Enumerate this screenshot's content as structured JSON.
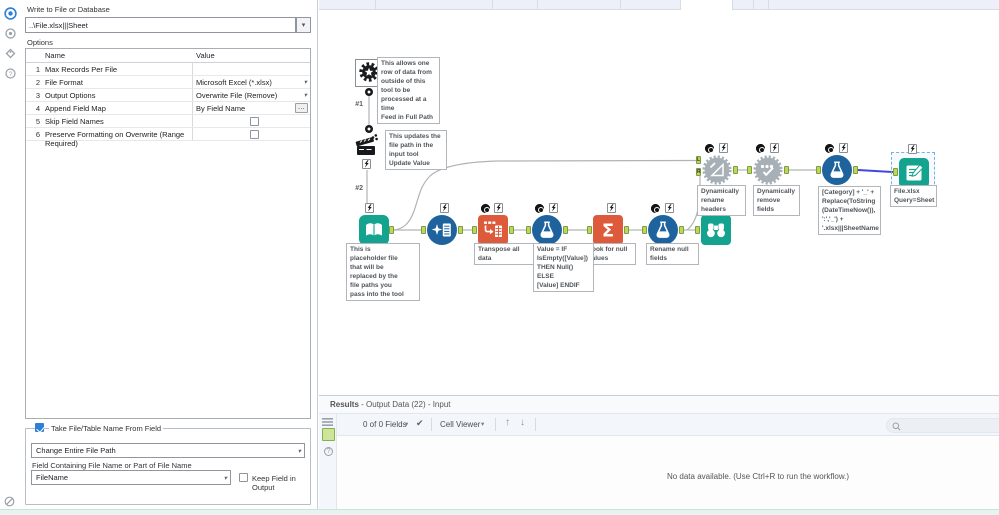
{
  "config_panel": {
    "title": "Write to File or Database",
    "path_value": "..\\File.xlsx|||Sheet",
    "options_label": "Options",
    "table": {
      "col_name": "Name",
      "col_value": "Value",
      "rows": [
        {
          "num": "1",
          "name": "Max Records Per File",
          "value": "",
          "type": "text"
        },
        {
          "num": "2",
          "name": "File Format",
          "value": "Microsoft Excel (*.xlsx)",
          "type": "select"
        },
        {
          "num": "3",
          "name": "Output Options",
          "value": "Overwrite File (Remove)",
          "type": "select"
        },
        {
          "num": "4",
          "name": "Append Field Map",
          "value": "By Field Name",
          "type": "button"
        },
        {
          "num": "5",
          "name": "Skip Field Names",
          "value": "",
          "type": "checkbox",
          "checked": false
        },
        {
          "num": "6",
          "name": "Preserve Formatting on Overwrite (Range Required)",
          "value": "",
          "type": "checkbox",
          "checked": false
        }
      ]
    },
    "group": {
      "legend": "Take File/Table Name From Field",
      "legend_checked": true,
      "mode_select": "Change Entire File Path",
      "field_label": "Field Containing File Name or Part of File Name",
      "field_select": "FileName",
      "keep_checkbox_label": "Keep Field in Output",
      "keep_checked": false
    }
  },
  "canvas": {
    "connection_labels": {
      "c1": "#1",
      "c2": "#2"
    },
    "anchor_letters": {
      "l": "L",
      "r": "R"
    },
    "comments": {
      "macro_input": "This allows one\nrow of data from\noutside of this\ntool to be\nprocessed at a\ntime\nFeed in Full Path",
      "action": "This updates the\nfile path in the\ninput tool\nUpdate Value",
      "input_data": "This is\nplaceholder file\nthat will be\nreplaced by the\nfile paths you\npass into the tool"
    },
    "captions": {
      "transpose": "Transpose all data",
      "formula1": "Value = IF\nIsEmpty([Value])\nTHEN Null() ELSE\n[Value] ENDIF",
      "summarize": "Look for null\nvalues",
      "formula2": "Rename null\nfields",
      "dynamic_rename": "Dynamically\nrename headers",
      "dynamic_select": "Dynamically\nremove fields",
      "formula3": "[Category] + '_' +\nReplace(ToString\n(DateTimeNow()),\n':','_') +\n'.xlsx|||SheetName",
      "output": "File.xlsx\nQuery=Sheet"
    }
  },
  "results_panel": {
    "title_bold": "Results",
    "title_rest": " - Output Data (22) - Input",
    "fields_count": "0 of 0 Fields",
    "cell_viewer_label": "Cell Viewer",
    "empty_message": "No data available. (Use Ctrl+R to run the workflow.)"
  },
  "colors": {
    "accent_blue": "#2f7fd6",
    "tool_teal": "#13a38e",
    "tool_blue": "#1e639e",
    "tool_red": "#dd5a3b",
    "tool_gray": "#a7b0b6",
    "selected_wire": "#3f49d8"
  }
}
